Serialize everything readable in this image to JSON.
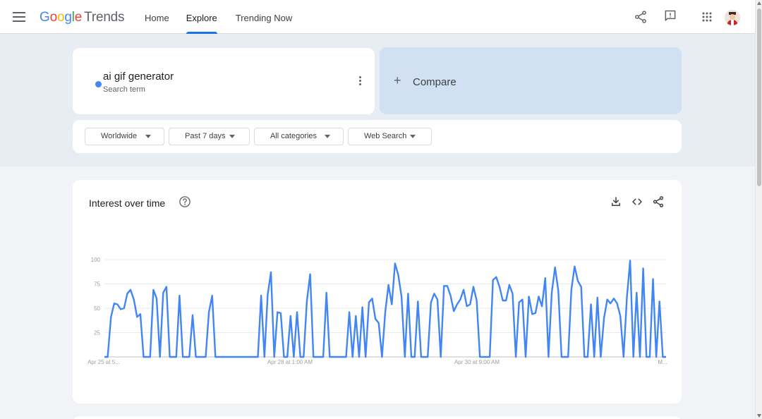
{
  "header": {
    "logo": {
      "google": "Google",
      "trends": "Trends"
    },
    "nav": [
      {
        "label": "Home",
        "active": false
      },
      {
        "label": "Explore",
        "active": true
      },
      {
        "label": "Trending Now",
        "active": false
      }
    ],
    "icons": [
      "menu-icon",
      "share-icon",
      "feedback-icon",
      "apps-grid-icon",
      "avatar"
    ]
  },
  "search": {
    "term": "ai gif generator",
    "term_type": "Search term",
    "term_color": "#4285f4",
    "compare_label": "Compare"
  },
  "filters": [
    {
      "label": "Worldwide"
    },
    {
      "label": "Past 7 days"
    },
    {
      "label": "All categories"
    },
    {
      "label": "Web Search"
    }
  ],
  "chart_card": {
    "title": "Interest over time",
    "icons": [
      "help-icon",
      "download-icon",
      "embed-icon",
      "share-icon"
    ]
  },
  "chart_data": {
    "type": "line",
    "title": "Interest over time",
    "ylim": [
      0,
      100
    ],
    "y_ticks": [
      "100",
      "75",
      "50",
      "25"
    ],
    "x_tick_labels": [
      "Apr 25 at 5...",
      "Apr 28 at 1:00 AM",
      "Apr 30 at 9:00 AM",
      "M..."
    ],
    "grid": true,
    "color": "#4285f4",
    "series": [
      {
        "values": [
          0,
          0,
          41,
          55,
          54,
          49,
          50,
          65,
          69,
          59,
          41,
          44,
          0,
          0,
          0,
          69,
          60,
          0,
          66,
          72,
          0,
          0,
          0,
          63,
          0,
          0,
          0,
          43,
          0,
          0,
          0,
          0,
          46,
          63,
          0,
          0,
          0,
          0,
          0,
          0,
          0,
          0,
          0,
          0,
          0,
          0,
          0,
          0,
          63,
          0,
          64,
          87,
          0,
          46,
          45,
          0,
          0,
          42,
          0,
          46,
          0,
          0,
          57,
          85,
          0,
          0,
          0,
          0,
          66,
          0,
          0,
          0,
          0,
          0,
          0,
          46,
          0,
          42,
          0,
          51,
          0,
          56,
          60,
          39,
          35,
          0,
          46,
          74,
          54,
          96,
          84,
          62,
          0,
          65,
          0,
          0,
          57,
          0,
          0,
          0,
          56,
          65,
          59,
          0,
          73,
          73,
          63,
          47,
          54,
          59,
          69,
          52,
          54,
          72,
          58,
          0,
          0,
          0,
          0,
          79,
          82,
          72,
          58,
          58,
          74,
          65,
          0,
          56,
          59,
          0,
          62,
          44,
          45,
          62,
          52,
          81,
          0,
          66,
          92,
          68,
          0,
          0,
          0,
          69,
          93,
          78,
          72,
          0,
          0,
          54,
          0,
          61,
          0,
          40,
          59,
          55,
          60,
          55,
          42,
          0,
          61,
          99,
          0,
          66,
          0,
          91,
          0,
          0,
          80,
          0,
          57,
          0,
          0
        ]
      }
    ]
  }
}
